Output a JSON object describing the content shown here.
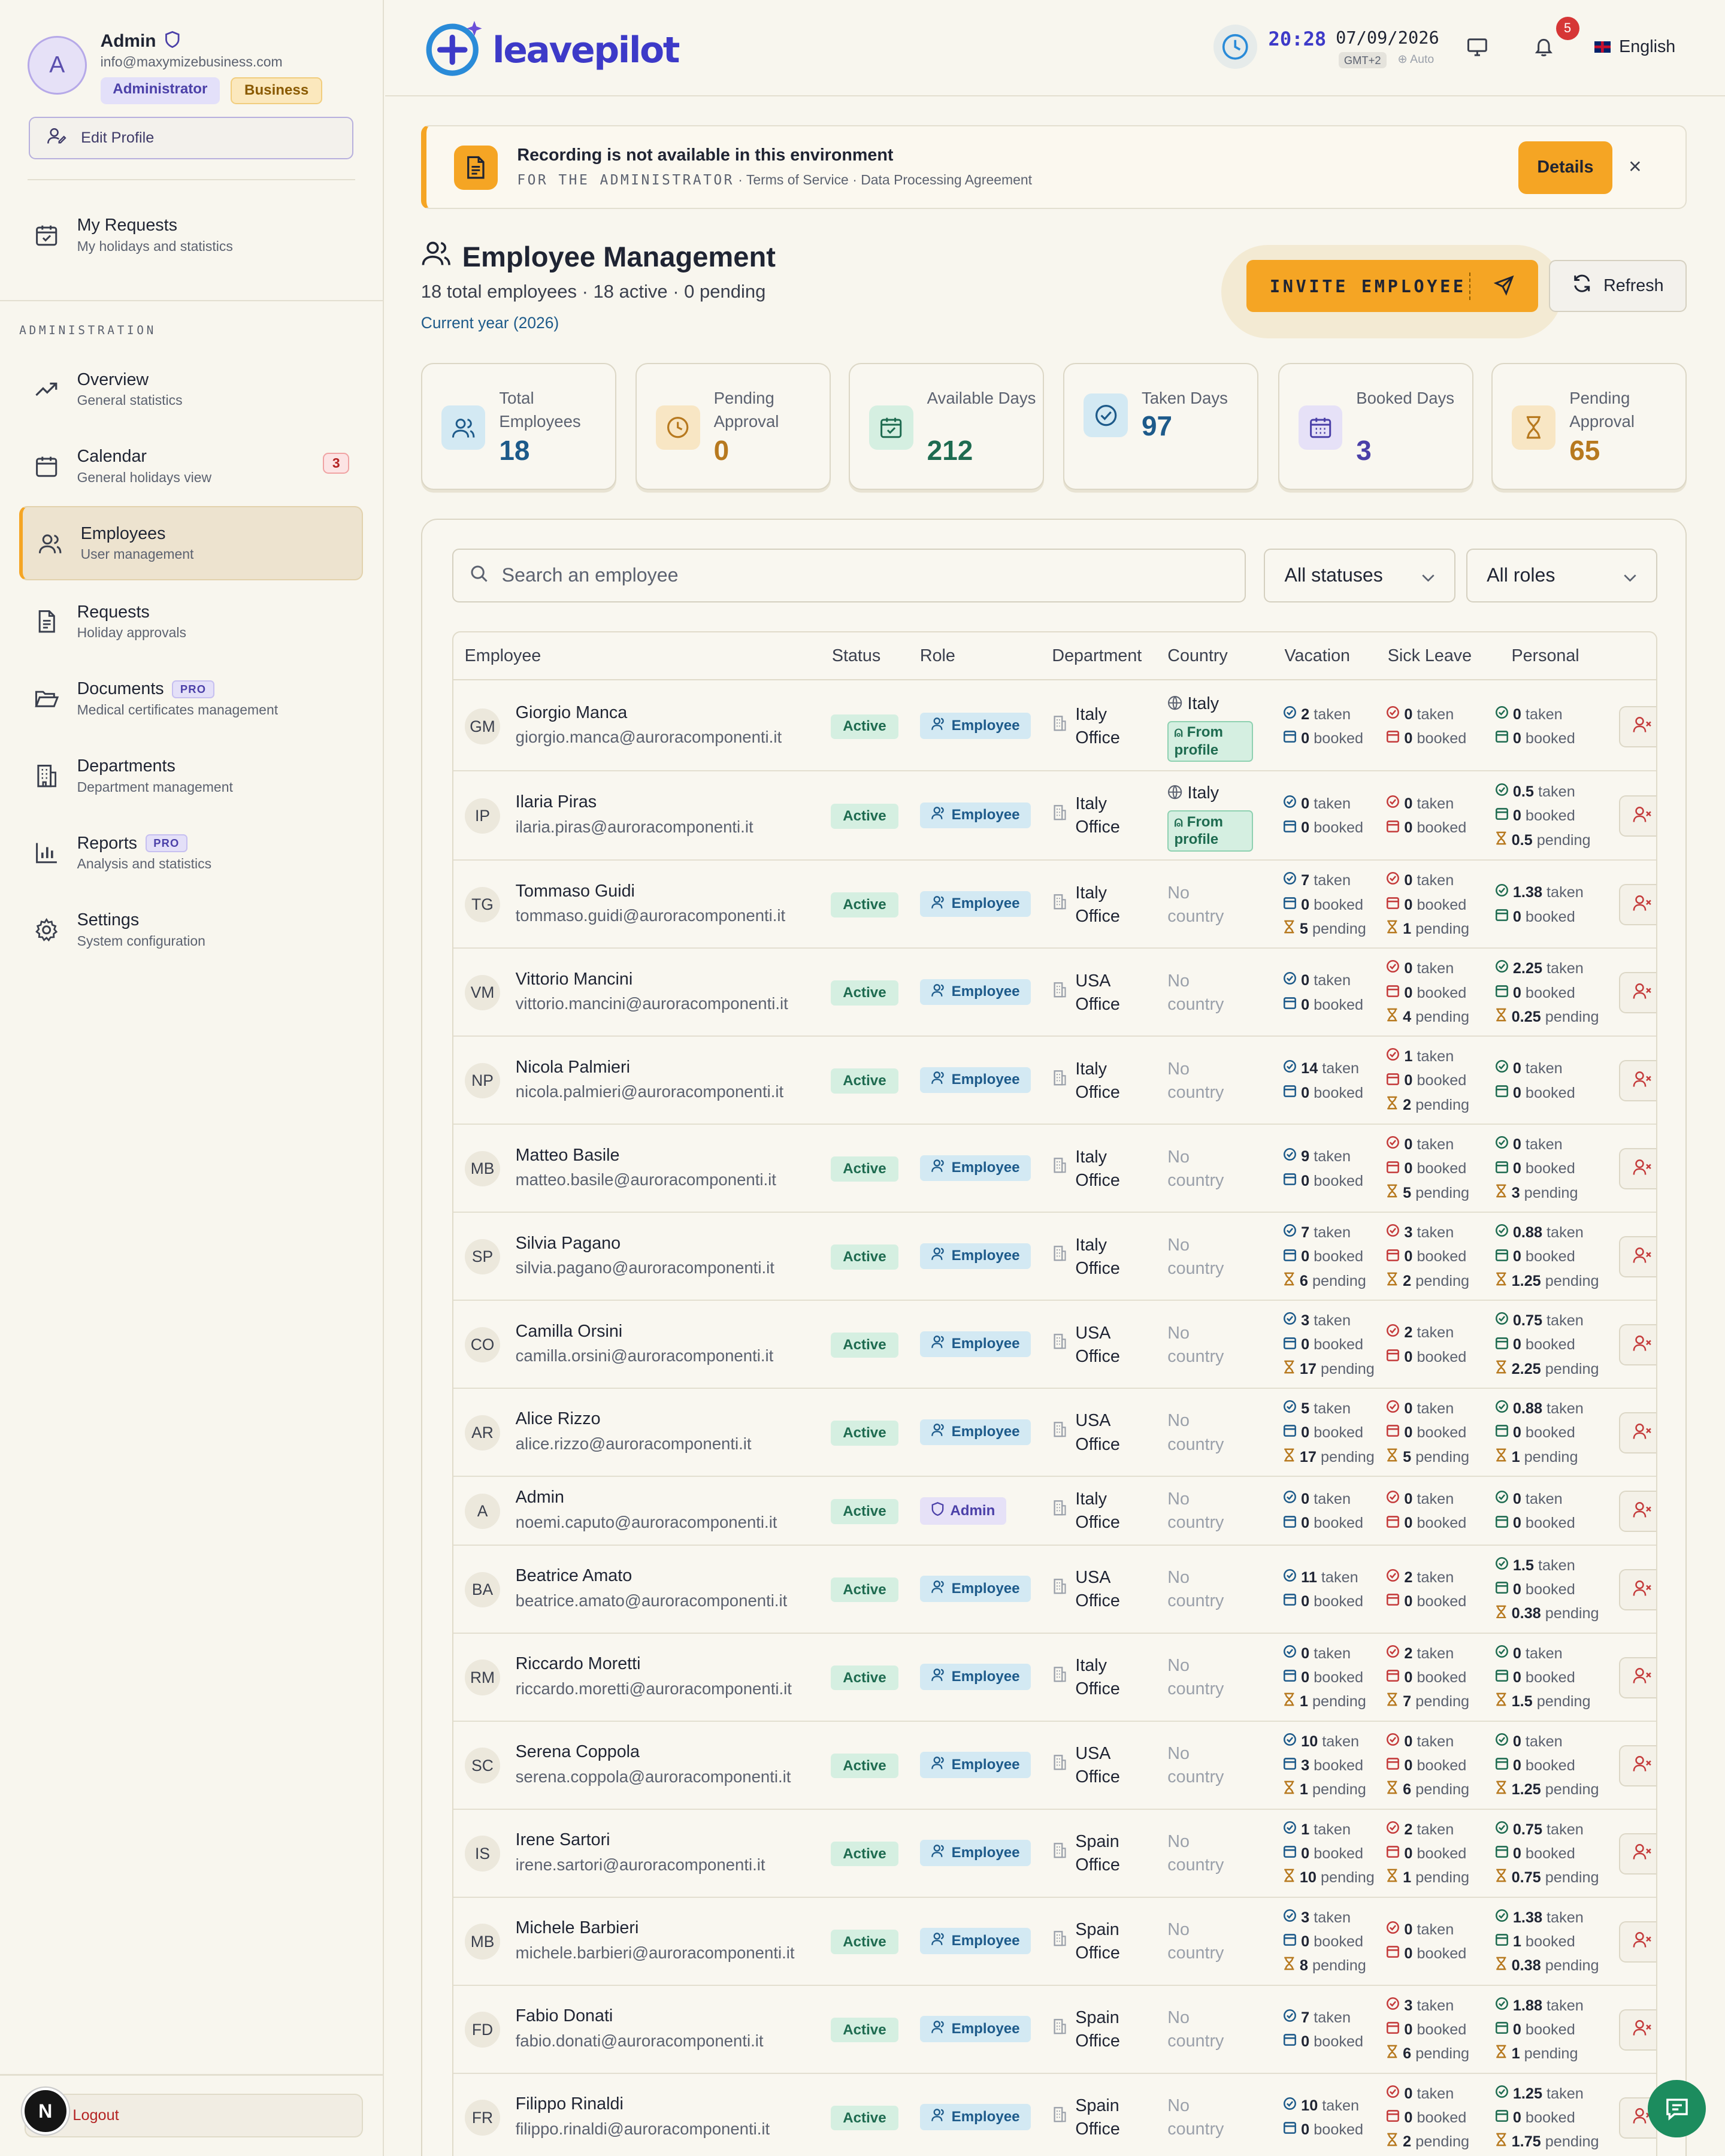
{
  "profile": {
    "initial": "A",
    "name": "Admin",
    "email": "info@maxymizebusiness.com",
    "badge_role": "Administrator",
    "badge_plan": "Business",
    "edit_label": "Edit Profile"
  },
  "nav_top": {
    "title": "My Requests",
    "sub": "My holidays and statistics"
  },
  "admin_label": "ADMINISTRATION",
  "nav": [
    {
      "title": "Overview",
      "sub": "General statistics"
    },
    {
      "title": "Calendar",
      "sub": "General holidays view",
      "count": "3"
    },
    {
      "title": "Employees",
      "sub": "User management"
    },
    {
      "title": "Requests",
      "sub": "Holiday approvals"
    },
    {
      "title": "Documents",
      "sub": "Medical certificates management",
      "pro": "PRO"
    },
    {
      "title": "Departments",
      "sub": "Department management"
    },
    {
      "title": "Reports",
      "sub": "Analysis and statistics",
      "pro": "PRO"
    },
    {
      "title": "Settings",
      "sub": "System configuration"
    }
  ],
  "logout_label": "Logout",
  "bubble_letter": "N",
  "header": {
    "logo": "leavepilot",
    "time": "20:28",
    "date": "07/09/2026",
    "tz": "GMT+2",
    "auto": "Auto",
    "notif_count": "5",
    "language": "English"
  },
  "banner": {
    "title": "Recording is not available in this environment",
    "for_label": "FOR THE ADMINISTRATOR",
    "links": "· Terms of Service · Data Processing Agreement",
    "details": "Details",
    "close": "×"
  },
  "page": {
    "title": "Employee Management",
    "subtitle": "18 total employees · 18 active · 0 pending",
    "year": "Current year (2026)",
    "invite": "INVITE EMPLOYEE",
    "refresh": "Refresh"
  },
  "stats": [
    {
      "label": "Total Employees",
      "value": "18",
      "color": "#1d5a8a",
      "bg": "#d3e9f3"
    },
    {
      "label": "Pending Approval",
      "value": "0",
      "color": "#b7791f",
      "bg": "#f8e6c4"
    },
    {
      "label": "Available Days",
      "value": "212",
      "color": "#1e6b50",
      "bg": "#d5efe1"
    },
    {
      "label": "Taken Days",
      "value": "97",
      "color": "#1d5a8a",
      "bg": "#d3e9f3"
    },
    {
      "label": "Booked Days",
      "value": "3",
      "color": "#4b40a8",
      "bg": "#e6e1f7"
    },
    {
      "label": "Pending Approval",
      "value": "65",
      "color": "#b7791f",
      "bg": "#f8e6c4"
    }
  ],
  "filters": {
    "search_placeholder": "Search an employee",
    "status": "All statuses",
    "role": "All roles"
  },
  "columns": [
    "Employee",
    "Status",
    "Role",
    "Department",
    "Country",
    "Vacation",
    "Sick Leave",
    "Personal"
  ],
  "labels": {
    "taken": "taken",
    "booked": "booked",
    "pending": "pending",
    "from_profile": "From profile"
  },
  "employees": [
    {
      "ini": "GM",
      "name": "Giorgio Manca",
      "email": "giorgio.manca@auroracomponenti.it",
      "status": "Active",
      "role": "Employee",
      "dept": [
        "Italy",
        "Office"
      ],
      "country": "Italy",
      "from_profile": true,
      "vac": [
        "2",
        "0",
        null
      ],
      "sick": [
        "0",
        "0",
        null
      ],
      "pers": [
        "0",
        "0",
        null
      ]
    },
    {
      "ini": "IP",
      "name": "Ilaria Piras",
      "email": "ilaria.piras@auroracomponenti.it",
      "status": "Active",
      "role": "Employee",
      "dept": [
        "Italy",
        "Office"
      ],
      "country": "Italy",
      "from_profile": true,
      "vac": [
        "0",
        "0",
        null
      ],
      "sick": [
        "0",
        "0",
        null
      ],
      "pers": [
        "0.5",
        "0",
        "0.5"
      ]
    },
    {
      "ini": "TG",
      "name": "Tommaso Guidi",
      "email": "tommaso.guidi@auroracomponenti.it",
      "status": "Active",
      "role": "Employee",
      "dept": [
        "Italy",
        "Office"
      ],
      "country": "No country",
      "vac": [
        "7",
        "0",
        "5"
      ],
      "sick": [
        "0",
        "0",
        "1"
      ],
      "pers": [
        "1.38",
        "0",
        null
      ]
    },
    {
      "ini": "VM",
      "name": "Vittorio Mancini",
      "email": "vittorio.mancini@auroracomponenti.it",
      "status": "Active",
      "role": "Employee",
      "dept": [
        "USA",
        "Office"
      ],
      "country": "No country",
      "vac": [
        "0",
        "0",
        null
      ],
      "sick": [
        "0",
        "0",
        "4"
      ],
      "pers": [
        "2.25",
        "0",
        "0.25"
      ]
    },
    {
      "ini": "NP",
      "name": "Nicola Palmieri",
      "email": "nicola.palmieri@auroracomponenti.it",
      "status": "Active",
      "role": "Employee",
      "dept": [
        "Italy",
        "Office"
      ],
      "country": "No country",
      "vac": [
        "14",
        "0",
        null
      ],
      "sick": [
        "1",
        "0",
        "2"
      ],
      "pers": [
        "0",
        "0",
        null
      ]
    },
    {
      "ini": "MB",
      "name": "Matteo Basile",
      "email": "matteo.basile@auroracomponenti.it",
      "status": "Active",
      "role": "Employee",
      "dept": [
        "Italy",
        "Office"
      ],
      "country": "No country",
      "vac": [
        "9",
        "0",
        null
      ],
      "sick": [
        "0",
        "0",
        "5"
      ],
      "pers": [
        "0",
        "0",
        "3"
      ]
    },
    {
      "ini": "SP",
      "name": "Silvia Pagano",
      "email": "silvia.pagano@auroracomponenti.it",
      "status": "Active",
      "role": "Employee",
      "dept": [
        "Italy",
        "Office"
      ],
      "country": "No country",
      "vac": [
        "7",
        "0",
        "6"
      ],
      "sick": [
        "3",
        "0",
        "2"
      ],
      "pers": [
        "0.88",
        "0",
        "1.25"
      ]
    },
    {
      "ini": "CO",
      "name": "Camilla Orsini",
      "email": "camilla.orsini@auroracomponenti.it",
      "status": "Active",
      "role": "Employee",
      "dept": [
        "USA",
        "Office"
      ],
      "country": "No country",
      "vac": [
        "3",
        "0",
        "17"
      ],
      "sick": [
        "2",
        "0",
        null
      ],
      "pers": [
        "0.75",
        "0",
        "2.25"
      ]
    },
    {
      "ini": "AR",
      "name": "Alice Rizzo",
      "email": "alice.rizzo@auroracomponenti.it",
      "status": "Active",
      "role": "Employee",
      "dept": [
        "USA",
        "Office"
      ],
      "country": "No country",
      "vac": [
        "5",
        "0",
        "17"
      ],
      "sick": [
        "0",
        "0",
        "5"
      ],
      "pers": [
        "0.88",
        "0",
        "1"
      ]
    },
    {
      "ini": "A",
      "name": "Admin",
      "email": "noemi.caputo@auroracomponenti.it",
      "status": "Active",
      "role": "Admin",
      "dept": [
        "Italy",
        "Office"
      ],
      "country": "No country",
      "vac": [
        "0",
        "0",
        null
      ],
      "sick": [
        "0",
        "0",
        null
      ],
      "pers": [
        "0",
        "0",
        null
      ]
    },
    {
      "ini": "BA",
      "name": "Beatrice Amato",
      "email": "beatrice.amato@auroracomponenti.it",
      "status": "Active",
      "role": "Employee",
      "dept": [
        "USA",
        "Office"
      ],
      "country": "No country",
      "vac": [
        "11",
        "0",
        null
      ],
      "sick": [
        "2",
        "0",
        null
      ],
      "pers": [
        "1.5",
        "0",
        "0.38"
      ]
    },
    {
      "ini": "RM",
      "name": "Riccardo Moretti",
      "email": "riccardo.moretti@auroracomponenti.it",
      "status": "Active",
      "role": "Employee",
      "dept": [
        "Italy",
        "Office"
      ],
      "country": "No country",
      "vac": [
        "0",
        "0",
        "1"
      ],
      "sick": [
        "2",
        "0",
        "7"
      ],
      "pers": [
        "0",
        "0",
        "1.5"
      ]
    },
    {
      "ini": "SC",
      "name": "Serena Coppola",
      "email": "serena.coppola@auroracomponenti.it",
      "status": "Active",
      "role": "Employee",
      "dept": [
        "USA",
        "Office"
      ],
      "country": "No country",
      "vac": [
        "10",
        "3",
        "1"
      ],
      "sick": [
        "0",
        "0",
        "6"
      ],
      "pers": [
        "0",
        "0",
        "1.25"
      ]
    },
    {
      "ini": "IS",
      "name": "Irene Sartori",
      "email": "irene.sartori@auroracomponenti.it",
      "status": "Active",
      "role": "Employee",
      "dept": [
        "Spain",
        "Office"
      ],
      "country": "No country",
      "vac": [
        "1",
        "0",
        "10"
      ],
      "sick": [
        "2",
        "0",
        "1"
      ],
      "pers": [
        "0.75",
        "0",
        "0.75"
      ]
    },
    {
      "ini": "MB",
      "name": "Michele Barbieri",
      "email": "michele.barbieri@auroracomponenti.it",
      "status": "Active",
      "role": "Employee",
      "dept": [
        "Spain",
        "Office"
      ],
      "country": "No country",
      "vac": [
        "3",
        "0",
        "8"
      ],
      "sick": [
        "0",
        "0",
        null
      ],
      "pers": [
        "1.38",
        "1",
        "0.38"
      ]
    },
    {
      "ini": "FD",
      "name": "Fabio Donati",
      "email": "fabio.donati@auroracomponenti.it",
      "status": "Active",
      "role": "Employee",
      "dept": [
        "Spain",
        "Office"
      ],
      "country": "No country",
      "vac": [
        "7",
        "0",
        null
      ],
      "sick": [
        "3",
        "0",
        "6"
      ],
      "pers": [
        "1.88",
        "0",
        "1"
      ]
    },
    {
      "ini": "FR",
      "name": "Filippo Rinaldi",
      "email": "filippo.rinaldi@auroracomponenti.it",
      "status": "Active",
      "role": "Employee",
      "dept": [
        "Spain",
        "Office"
      ],
      "country": "No country",
      "vac": [
        "10",
        "0",
        null
      ],
      "sick": [
        "0",
        "0",
        "2"
      ],
      "pers": [
        "1.25",
        "0",
        "1.75"
      ]
    }
  ]
}
